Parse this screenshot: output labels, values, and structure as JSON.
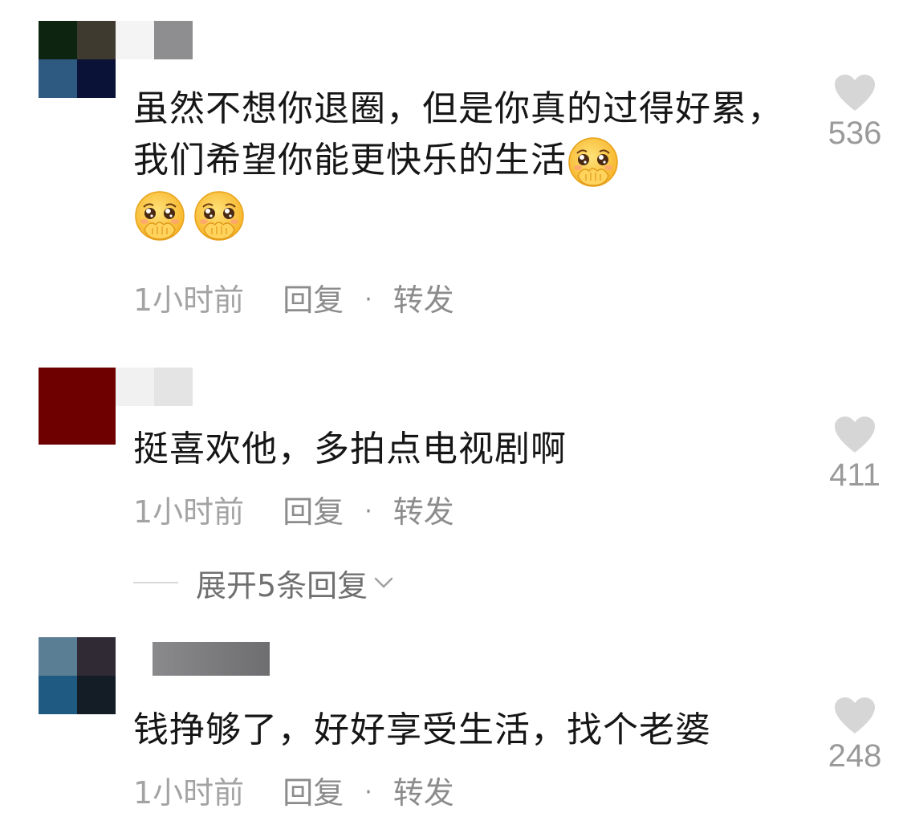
{
  "comments": [
    {
      "text": "虽然不想你退圈，但是你真的过得好累，我们希望你能更快乐的生活",
      "emoji": [
        "pleading-face-covering-mouth",
        "pleading-face-covering-mouth",
        "pleading-face-covering-mouth"
      ],
      "time": "1小时前",
      "reply_label": "回复",
      "separator": "·",
      "share_label": "转发",
      "likes": "536"
    },
    {
      "text": "挺喜欢他，多拍点电视剧啊",
      "time": "1小时前",
      "reply_label": "回复",
      "separator": "·",
      "share_label": "转发",
      "likes": "411",
      "expand_label": "展开5条回复"
    },
    {
      "text": "钱挣够了，好好享受生活，找个老婆",
      "time": "1小时前",
      "reply_label": "回复",
      "separator": "·",
      "share_label": "转发",
      "likes": "248"
    }
  ],
  "colors": {
    "text": "#161616",
    "meta": "#8c8c8c",
    "like_icon": "#d6d6d6",
    "like_count": "#9a9a9a"
  }
}
